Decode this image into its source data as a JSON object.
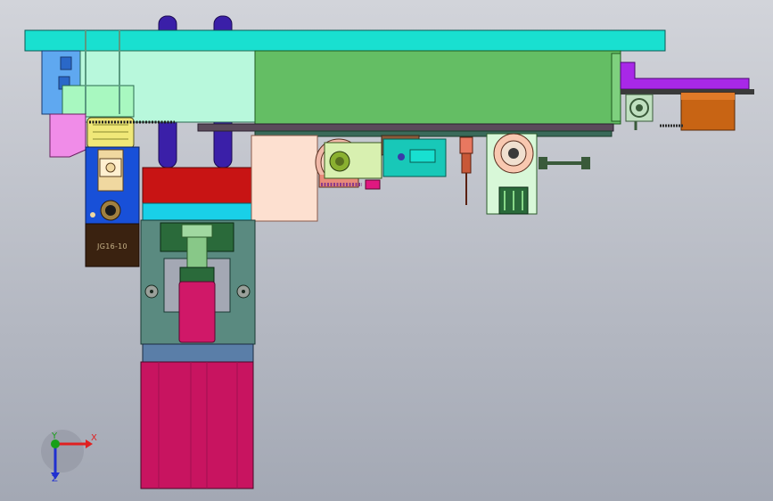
{
  "viewport": {
    "background_top": "#d2d4da",
    "background_bottom": "#a3a8b4"
  },
  "parts": {
    "cylinder_label": "JG16-10"
  },
  "triad": {
    "x_label": "X",
    "y_label": "Y",
    "z_label": "Z",
    "x_color": "#e02020",
    "y_color": "#18a018",
    "z_color": "#2030d0"
  }
}
